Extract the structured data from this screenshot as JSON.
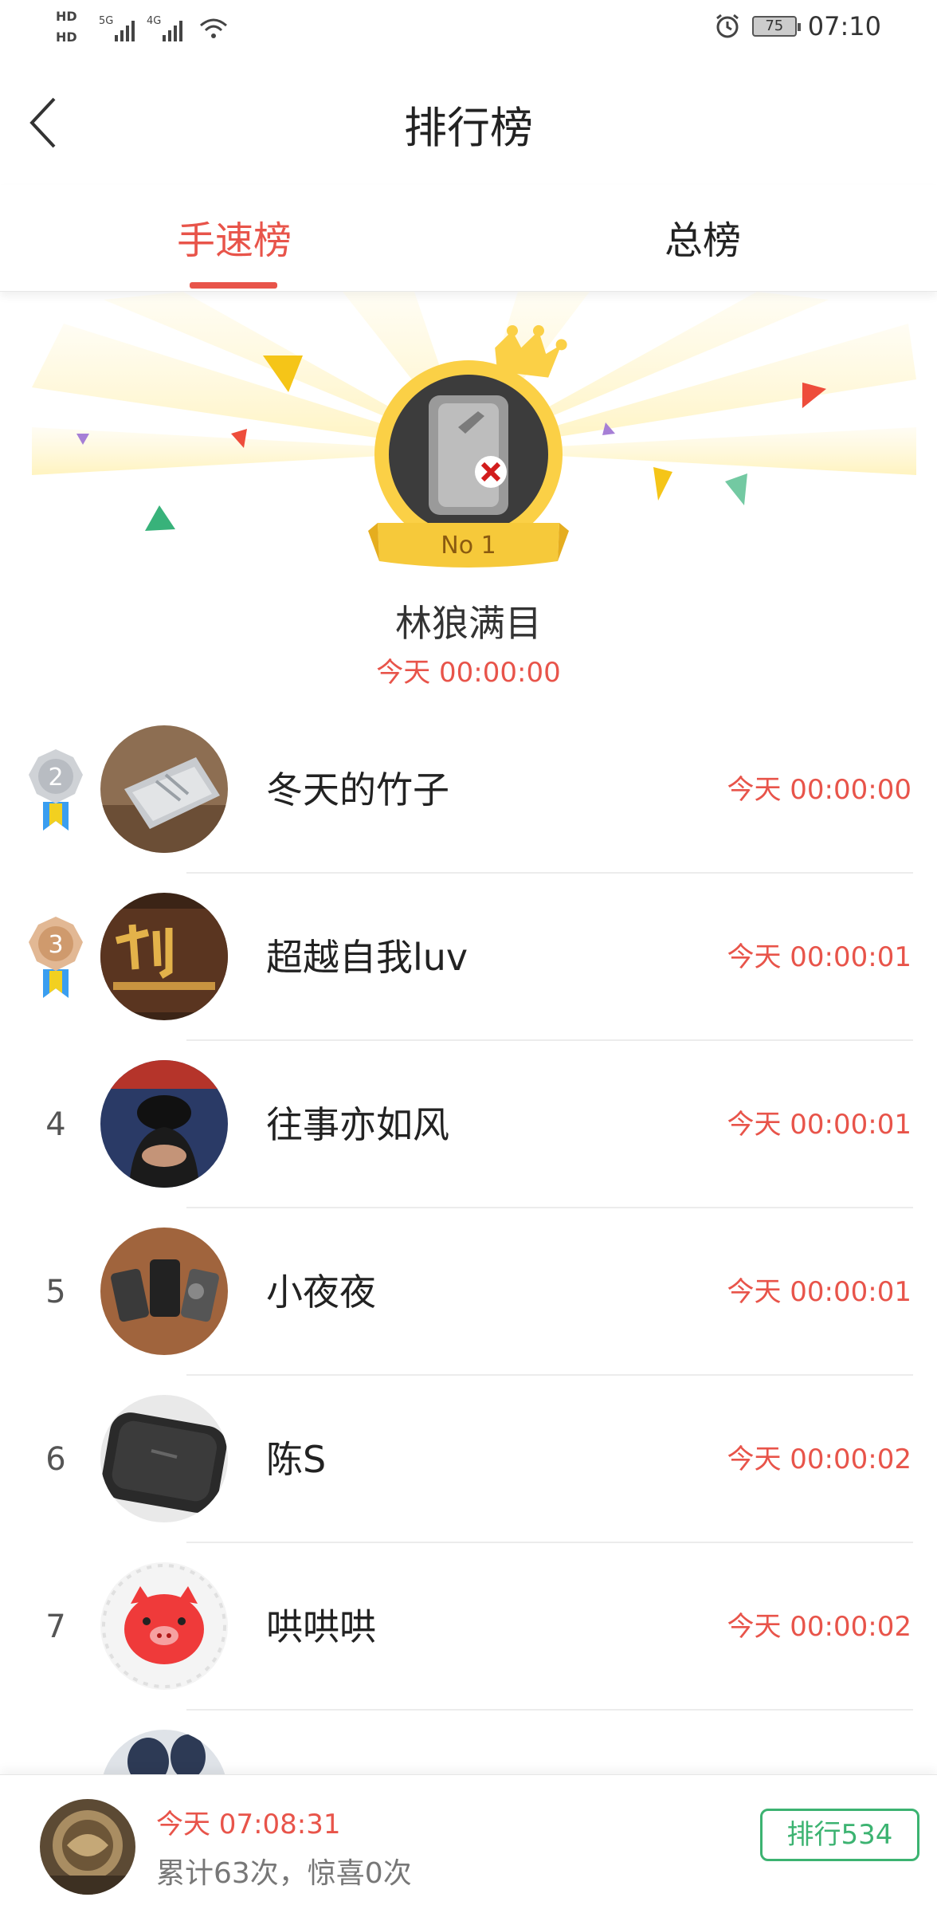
{
  "status_bar": {
    "hd1": "HD",
    "hd2": "HD",
    "net1": "5G",
    "net2": "4G",
    "battery": "75",
    "time": "07:10"
  },
  "header": {
    "title": "排行榜"
  },
  "tabs": [
    {
      "label": "手速榜",
      "active": true
    },
    {
      "label": "总榜",
      "active": false
    }
  ],
  "champion": {
    "badge": "No 1",
    "name": "林狼满目",
    "time": "今天 00:00:00"
  },
  "rankings": [
    {
      "rank": "2",
      "name": "冬天的竹子",
      "time": "今天 00:00:00",
      "medal": "silver"
    },
    {
      "rank": "3",
      "name": "超越自我luv",
      "time": "今天 00:00:01",
      "medal": "bronze"
    },
    {
      "rank": "4",
      "name": "往事亦如风",
      "time": "今天 00:00:01"
    },
    {
      "rank": "5",
      "name": "小夜夜",
      "time": "今天 00:00:01"
    },
    {
      "rank": "6",
      "name": "陈S",
      "time": "今天 00:00:02"
    },
    {
      "rank": "7",
      "name": "哄哄哄",
      "time": "今天 00:00:02"
    }
  ],
  "bottom": {
    "time": "今天 07:08:31",
    "stats": "累计63次，惊喜0次",
    "rank_button": "排行534"
  },
  "colors": {
    "accent": "#e8544a",
    "green": "#3cb371",
    "gold": "#f6c93a"
  }
}
